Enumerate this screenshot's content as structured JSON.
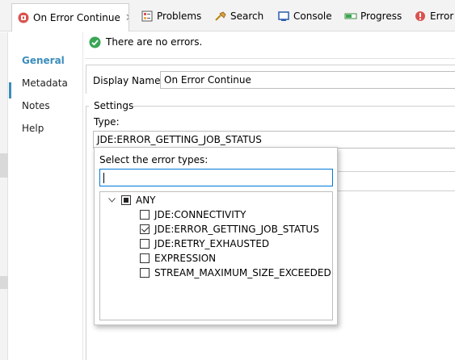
{
  "tabs": [
    {
      "label": "On Error Continue",
      "icon": "error-handler-icon",
      "active": true
    },
    {
      "label": "Problems",
      "icon": "problems-icon"
    },
    {
      "label": "Search",
      "icon": "search-icon"
    },
    {
      "label": "Console",
      "icon": "console-icon"
    },
    {
      "label": "Progress",
      "icon": "progress-icon"
    },
    {
      "label": "Error L",
      "icon": "error-log-icon"
    }
  ],
  "nav": [
    "General",
    "Metadata",
    "Notes",
    "Help"
  ],
  "status": {
    "text": "There are no errors.",
    "icon": "check-icon",
    "color": "#3aa655"
  },
  "form": {
    "display_name_label": "Display Name:",
    "display_name_value": "On Error Continue",
    "settings_label": "Settings",
    "type_label": "Type:",
    "type_value": "JDE:ERROR_GETTING_JOB_STATUS"
  },
  "popup": {
    "title": "Select the error types:",
    "search_value": "",
    "root": {
      "label": "ANY",
      "expanded": true
    },
    "items": [
      {
        "label": "JDE:CONNECTIVITY",
        "checked": false
      },
      {
        "label": "JDE:ERROR_GETTING_JOB_STATUS",
        "checked": true
      },
      {
        "label": "JDE:RETRY_EXHAUSTED",
        "checked": false
      },
      {
        "label": "EXPRESSION",
        "checked": false
      },
      {
        "label": "STREAM_MAXIMUM_SIZE_EXCEEDED",
        "checked": false
      }
    ]
  },
  "colors": {
    "accent": "#3c8dbc",
    "focus": "#0078d7"
  }
}
